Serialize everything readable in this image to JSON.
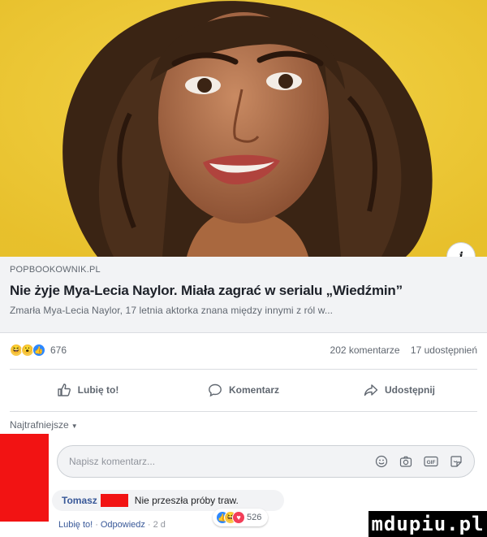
{
  "post": {
    "link": {
      "domain": "POPBOOKOWNIK.PL",
      "headline": "Nie żyje Mya-Lecia Naylor. Miała zagrać w serialu „Wiedźmin”",
      "summary": "Zmarła Mya-Lecia Naylor, 17 letnia aktorka znana między innymi z ról w..."
    },
    "stats": {
      "reaction_count": "676",
      "comments": "202 komentarze",
      "shares": "17 udostępnień",
      "reaction_icons": [
        "haha-icon",
        "wow-icon",
        "like-icon"
      ]
    },
    "actions": [
      {
        "label": "Lubię to!",
        "icon": "thumbs-up-icon"
      },
      {
        "label": "Komentarz",
        "icon": "speech-bubble-icon"
      },
      {
        "label": "Udostępnij",
        "icon": "share-arrow-icon"
      }
    ]
  },
  "comments_section": {
    "sort_label": "Najtrafniejsze",
    "input_placeholder": "Napisz komentarz...",
    "input_tools": [
      "emoji-icon",
      "camera-icon",
      "gif-icon",
      "sticker-icon"
    ],
    "comment": {
      "author": "Tomasz",
      "text": "Nie przeszła próby traw.",
      "like_label": "Lubię to!",
      "reply_label": "Odpowiedz",
      "time": "2 d",
      "reaction_count": "526",
      "reaction_icons": [
        "like-icon",
        "haha-icon",
        "love-icon"
      ]
    }
  },
  "watermark": "mdupiu.pl",
  "colors": {
    "photo_background": "#f0cf38",
    "link_blue": "#385898",
    "redaction": "#f21313",
    "like_blue": "#2d88ff"
  }
}
